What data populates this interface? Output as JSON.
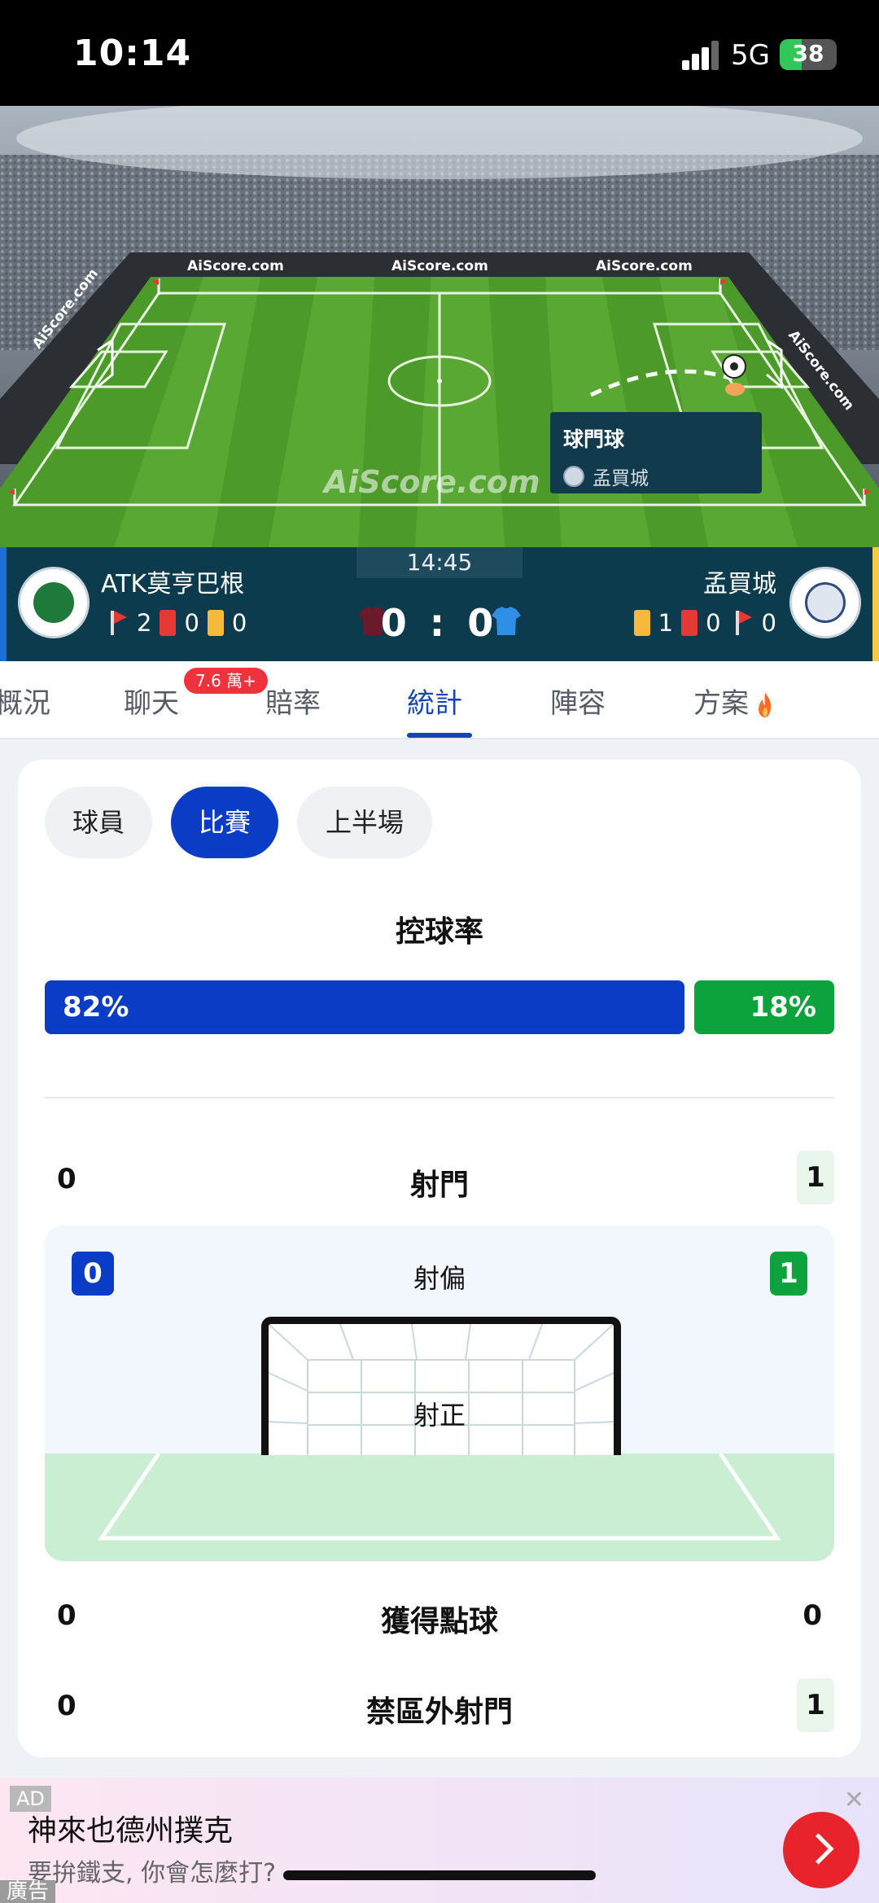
{
  "status_bar": {
    "time": "10:14",
    "network": "5G",
    "battery": "38",
    "battery_level": 0.38
  },
  "field": {
    "ads": [
      "AiScore.com",
      "AiScore.com",
      "AiScore.com",
      "AiScore.com",
      "AiScore.com",
      "AiScore.com"
    ],
    "event": {
      "title": "球門球",
      "team": "孟買城"
    }
  },
  "match": {
    "clock": "14:45",
    "score": "0 : 0",
    "home": {
      "name": "ATK莫亨巴根",
      "corners": "2",
      "red": "0",
      "yellow": "0",
      "color": "#6b1a2c"
    },
    "away": {
      "name": "孟買城",
      "yellow": "1",
      "red": "0",
      "corners": "0",
      "color": "#2f8ee6"
    }
  },
  "tabs": [
    {
      "label": "概況"
    },
    {
      "label": "聊天",
      "badge": "7.6 萬+"
    },
    {
      "label": "賠率"
    },
    {
      "label": "統計"
    },
    {
      "label": "陣容"
    },
    {
      "label": "方案"
    }
  ],
  "active_tab": "統計",
  "chips": [
    "球員",
    "比賽",
    "上半場"
  ],
  "active_chip": "比賽",
  "stats": {
    "possession": {
      "title": "控球率",
      "home": "82%",
      "away": "18%",
      "home_value": 82,
      "away_value": 18
    },
    "shots": {
      "label": "射門",
      "home": "0",
      "away": "1"
    },
    "off_target": {
      "label": "射偏",
      "home": "0",
      "away": "1"
    },
    "on_target": {
      "label": "射正"
    },
    "penalties": {
      "label": "獲得點球",
      "home": "0",
      "away": "0"
    },
    "outside_box": {
      "label": "禁區外射門",
      "home": "0",
      "away": "1"
    }
  },
  "ad": {
    "tag": "AD",
    "title": "神來也德州撲克",
    "subtitle": "要拚鐵支, 你會怎麼打?",
    "footer": "廣告",
    "close": "✕"
  },
  "colors": {
    "accent": "#0a3cc6",
    "away_green": "#0ca33c",
    "score_bg": "#0c3b4d"
  }
}
